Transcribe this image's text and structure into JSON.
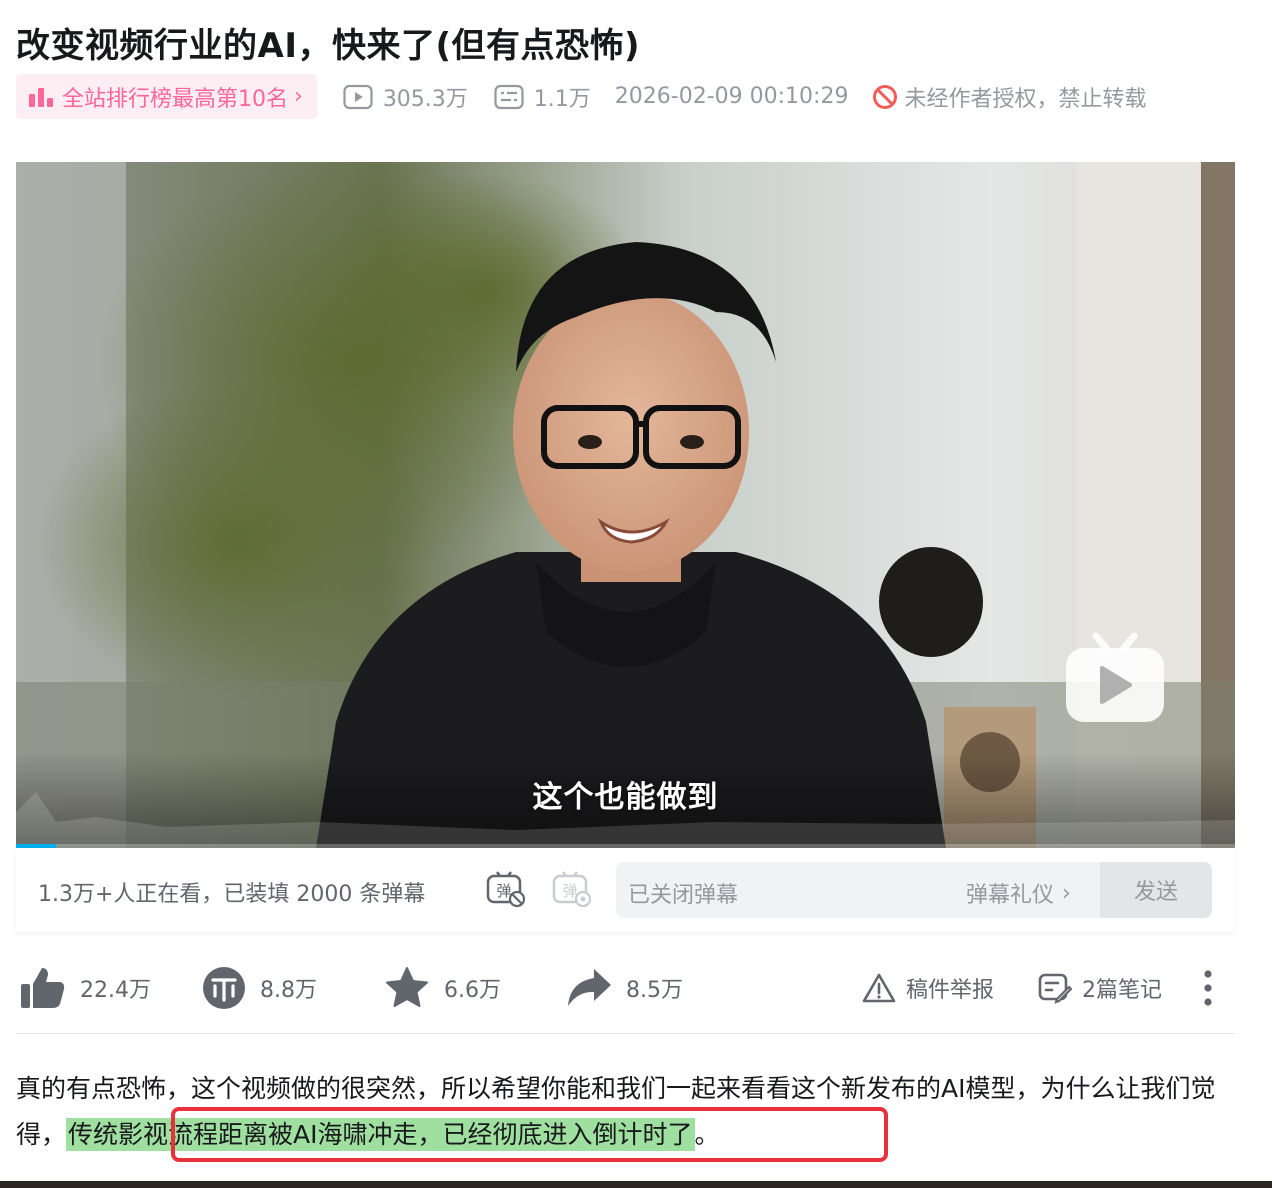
{
  "title": "改变视频行业的AI，快来了(但有点恐怖)",
  "meta": {
    "rank_label": "全站排行榜最高第10名",
    "rank_chevron": "›",
    "views": "305.3万",
    "danmaku_count": "1.1万",
    "pubdate": "2026-02-09 00:10:29",
    "copyright": "未经作者授权，禁止转载"
  },
  "player": {
    "subtitle": "这个也能做到",
    "progress_fraction": 0.033,
    "icons": [
      "bilibili-tv-icon"
    ]
  },
  "danmaku_bar": {
    "watching_text": "1.3万+人正在看，已装填 2000 条弹幕",
    "input_placeholder": "已关闭弹幕",
    "etiquette_label": "弹幕礼仪",
    "etiquette_chevron": "›",
    "send_label": "发送"
  },
  "actions": {
    "like": "22.4万",
    "coin": "8.8万",
    "favorite": "6.6万",
    "share": "8.5万",
    "report": "稿件举报",
    "notes": "2篇笔记"
  },
  "description": {
    "part1": "真的有点恐怖，这个视频做的很突然，所以希望你能和我们一起来看看这个新发布的AI模型，为什么让我们觉得，",
    "highlight": "传统影视流程距离被AI海啸冲走，已经彻底进入倒计时了",
    "part2": "。"
  },
  "colors": {
    "accent_pink": "#ff6699",
    "accent_blue": "#00aeec",
    "highlight_green": "#9fdf9f",
    "highlight_border": "#e8313b"
  }
}
